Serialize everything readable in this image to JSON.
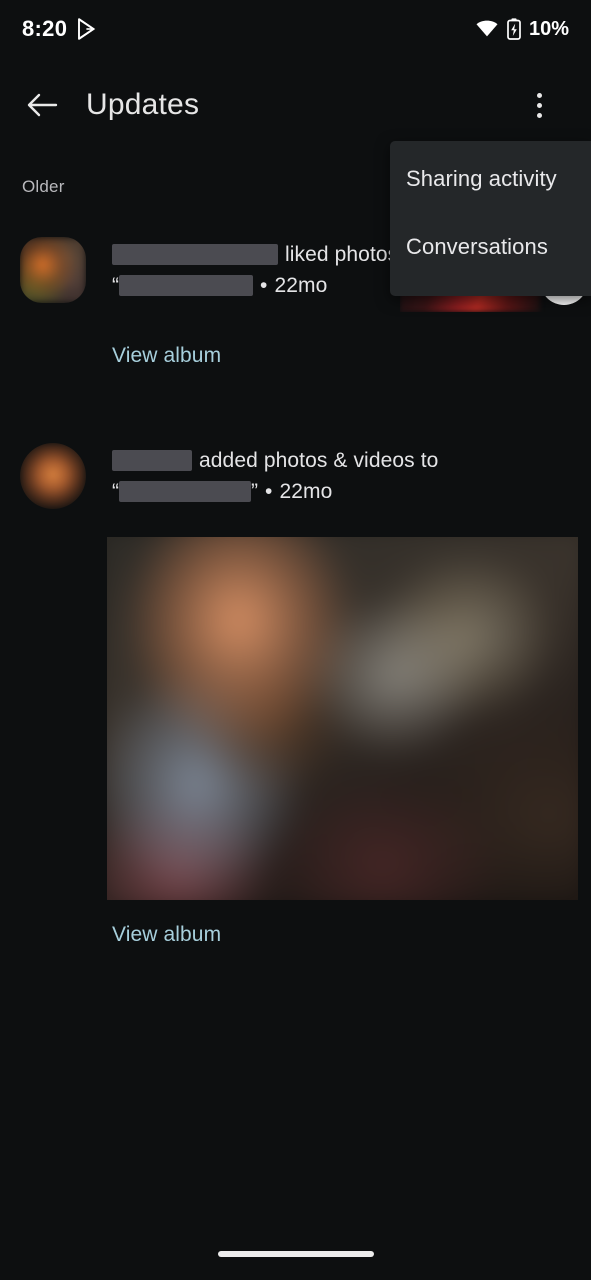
{
  "status_bar": {
    "time": "8:20",
    "battery_percent": "10%",
    "icons": [
      "play-store-icon",
      "wifi-icon",
      "battery-charging-icon"
    ]
  },
  "app_bar": {
    "title": "Updates",
    "back_icon": "back-arrow-icon",
    "overflow_icon": "overflow-menu-icon"
  },
  "overflow_menu": {
    "items": [
      {
        "label": "Sharing activity"
      },
      {
        "label": "Conversations"
      }
    ]
  },
  "content": {
    "section_label": "Older",
    "updates": [
      {
        "avatar": "user-avatar-rounded-square",
        "name": "[redacted]",
        "action": "liked photos",
        "quote_open": "“",
        "album": "[redacted]",
        "quote_close": "",
        "separator": "•",
        "time": "22mo",
        "link": "View album",
        "media": "photo-thumbnail-with-heart-badge"
      },
      {
        "avatar": "user-avatar-circle",
        "name": "[redacted]",
        "action": "added photos & videos to",
        "quote_open": "“",
        "album": "[redacted]",
        "quote_close": "”",
        "separator": "•",
        "time": "22mo",
        "link": "View album",
        "media": "photo-preview-blurred"
      }
    ]
  },
  "navigation": {
    "gesture_pill": "home-gesture-pill"
  },
  "colors": {
    "background": "#0d0f10",
    "menu_surface": "#242729",
    "link_accent": "#a7cfdc",
    "primary_text": "#e4e4e6",
    "secondary_text": "#b9b9bd",
    "redaction": "#4b4b51"
  }
}
